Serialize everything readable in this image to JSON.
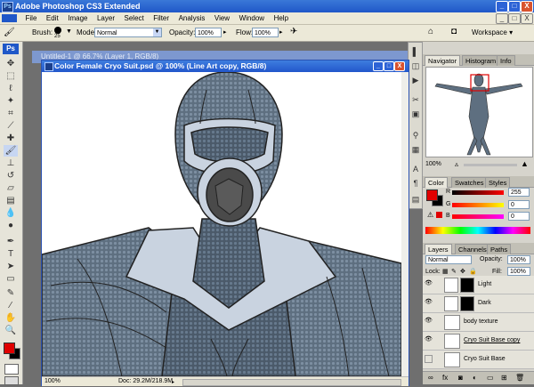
{
  "app": {
    "title": "Adobe Photoshop CS3 Extended",
    "logo": "Ps",
    "window_buttons": [
      "_",
      "□",
      "X"
    ]
  },
  "menu": [
    "File",
    "Edit",
    "Image",
    "Layer",
    "Select",
    "Filter",
    "Analysis",
    "View",
    "Window",
    "Help"
  ],
  "options": {
    "brush_label": "Brush:",
    "brush_size": "25",
    "mode_label": "Mode:",
    "mode_value": "Normal",
    "opacity_label": "Opacity:",
    "opacity_value": "100%",
    "flow_label": "Flow:",
    "flow_value": "100%",
    "workspace_label": "Workspace ▾"
  },
  "toolbox": {
    "logo": "Ps",
    "tools": [
      "move-tool",
      "marquee-tool",
      "lasso-tool",
      "magic-wand-tool",
      "crop-tool",
      "slice-tool",
      "healing-tool",
      "brush-tool",
      "clone-stamp-tool",
      "history-brush-tool",
      "eraser-tool",
      "gradient-tool",
      "blur-tool",
      "dodge-tool",
      "pen-tool",
      "type-tool",
      "path-selection-tool",
      "shape-tool",
      "notes-tool",
      "eyedropper-tool",
      "hand-tool",
      "zoom-tool"
    ],
    "foreground_color": "#e00000",
    "background_color": "#000000"
  },
  "documents": {
    "back_title": "Untitled-1 @ 66.7% (Layer 1, RGB/8)",
    "front_title": "Color Female Cryo Suit.psd @ 100% (Line Art copy, RGB/8)",
    "zoom": "100%",
    "doc_size": "Doc: 29.2M/218.9M"
  },
  "navigator": {
    "tabs": [
      "Navigator",
      "Histogram",
      "Info"
    ],
    "zoom": "100%"
  },
  "color_panel": {
    "tabs": [
      "Color",
      "Swatches",
      "Styles"
    ],
    "r_label": "R",
    "r_value": "255",
    "g_label": "G",
    "g_value": "0",
    "b_label": "B",
    "b_value": "0",
    "foreground": "#e00000"
  },
  "layers_panel": {
    "tabs": [
      "Layers",
      "Channels",
      "Paths"
    ],
    "blend_mode": "Normal",
    "opacity_label": "Opacity:",
    "opacity_value": "100%",
    "lock_label": "Lock:",
    "fill_label": "Fill:",
    "fill_value": "100%",
    "layers": [
      {
        "name": "Light"
      },
      {
        "name": "Dark"
      },
      {
        "name": "body texture"
      },
      {
        "name": "Cryo Suit Base copy"
      },
      {
        "name": "Cryo Suit Base"
      }
    ]
  }
}
